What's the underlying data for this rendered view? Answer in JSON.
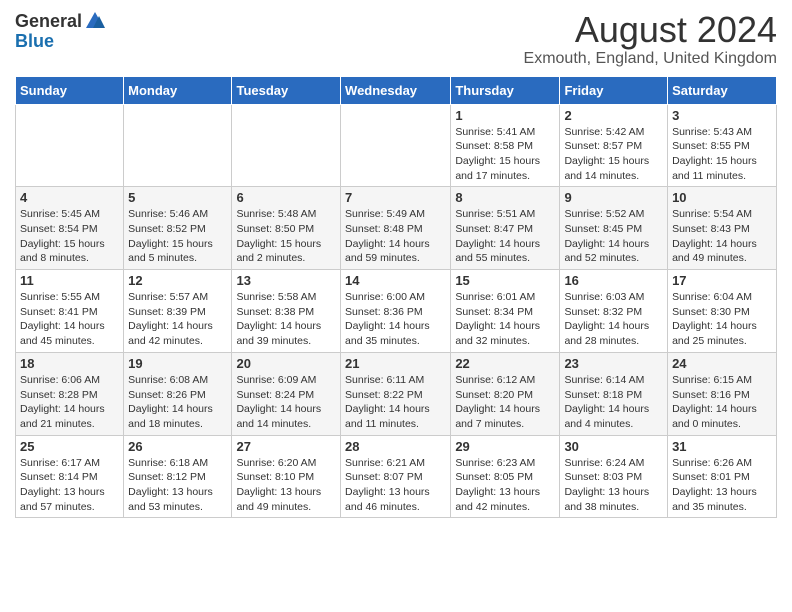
{
  "header": {
    "logo_general": "General",
    "logo_blue": "Blue",
    "title": "August 2024",
    "subtitle": "Exmouth, England, United Kingdom"
  },
  "weekdays": [
    "Sunday",
    "Monday",
    "Tuesday",
    "Wednesday",
    "Thursday",
    "Friday",
    "Saturday"
  ],
  "weeks": [
    [
      {
        "day": "",
        "sunrise": "",
        "sunset": "",
        "daylight": ""
      },
      {
        "day": "",
        "sunrise": "",
        "sunset": "",
        "daylight": ""
      },
      {
        "day": "",
        "sunrise": "",
        "sunset": "",
        "daylight": ""
      },
      {
        "day": "",
        "sunrise": "",
        "sunset": "",
        "daylight": ""
      },
      {
        "day": "1",
        "sunrise": "Sunrise: 5:41 AM",
        "sunset": "Sunset: 8:58 PM",
        "daylight": "Daylight: 15 hours and 17 minutes."
      },
      {
        "day": "2",
        "sunrise": "Sunrise: 5:42 AM",
        "sunset": "Sunset: 8:57 PM",
        "daylight": "Daylight: 15 hours and 14 minutes."
      },
      {
        "day": "3",
        "sunrise": "Sunrise: 5:43 AM",
        "sunset": "Sunset: 8:55 PM",
        "daylight": "Daylight: 15 hours and 11 minutes."
      }
    ],
    [
      {
        "day": "4",
        "sunrise": "Sunrise: 5:45 AM",
        "sunset": "Sunset: 8:54 PM",
        "daylight": "Daylight: 15 hours and 8 minutes."
      },
      {
        "day": "5",
        "sunrise": "Sunrise: 5:46 AM",
        "sunset": "Sunset: 8:52 PM",
        "daylight": "Daylight: 15 hours and 5 minutes."
      },
      {
        "day": "6",
        "sunrise": "Sunrise: 5:48 AM",
        "sunset": "Sunset: 8:50 PM",
        "daylight": "Daylight: 15 hours and 2 minutes."
      },
      {
        "day": "7",
        "sunrise": "Sunrise: 5:49 AM",
        "sunset": "Sunset: 8:48 PM",
        "daylight": "Daylight: 14 hours and 59 minutes."
      },
      {
        "day": "8",
        "sunrise": "Sunrise: 5:51 AM",
        "sunset": "Sunset: 8:47 PM",
        "daylight": "Daylight: 14 hours and 55 minutes."
      },
      {
        "day": "9",
        "sunrise": "Sunrise: 5:52 AM",
        "sunset": "Sunset: 8:45 PM",
        "daylight": "Daylight: 14 hours and 52 minutes."
      },
      {
        "day": "10",
        "sunrise": "Sunrise: 5:54 AM",
        "sunset": "Sunset: 8:43 PM",
        "daylight": "Daylight: 14 hours and 49 minutes."
      }
    ],
    [
      {
        "day": "11",
        "sunrise": "Sunrise: 5:55 AM",
        "sunset": "Sunset: 8:41 PM",
        "daylight": "Daylight: 14 hours and 45 minutes."
      },
      {
        "day": "12",
        "sunrise": "Sunrise: 5:57 AM",
        "sunset": "Sunset: 8:39 PM",
        "daylight": "Daylight: 14 hours and 42 minutes."
      },
      {
        "day": "13",
        "sunrise": "Sunrise: 5:58 AM",
        "sunset": "Sunset: 8:38 PM",
        "daylight": "Daylight: 14 hours and 39 minutes."
      },
      {
        "day": "14",
        "sunrise": "Sunrise: 6:00 AM",
        "sunset": "Sunset: 8:36 PM",
        "daylight": "Daylight: 14 hours and 35 minutes."
      },
      {
        "day": "15",
        "sunrise": "Sunrise: 6:01 AM",
        "sunset": "Sunset: 8:34 PM",
        "daylight": "Daylight: 14 hours and 32 minutes."
      },
      {
        "day": "16",
        "sunrise": "Sunrise: 6:03 AM",
        "sunset": "Sunset: 8:32 PM",
        "daylight": "Daylight: 14 hours and 28 minutes."
      },
      {
        "day": "17",
        "sunrise": "Sunrise: 6:04 AM",
        "sunset": "Sunset: 8:30 PM",
        "daylight": "Daylight: 14 hours and 25 minutes."
      }
    ],
    [
      {
        "day": "18",
        "sunrise": "Sunrise: 6:06 AM",
        "sunset": "Sunset: 8:28 PM",
        "daylight": "Daylight: 14 hours and 21 minutes."
      },
      {
        "day": "19",
        "sunrise": "Sunrise: 6:08 AM",
        "sunset": "Sunset: 8:26 PM",
        "daylight": "Daylight: 14 hours and 18 minutes."
      },
      {
        "day": "20",
        "sunrise": "Sunrise: 6:09 AM",
        "sunset": "Sunset: 8:24 PM",
        "daylight": "Daylight: 14 hours and 14 minutes."
      },
      {
        "day": "21",
        "sunrise": "Sunrise: 6:11 AM",
        "sunset": "Sunset: 8:22 PM",
        "daylight": "Daylight: 14 hours and 11 minutes."
      },
      {
        "day": "22",
        "sunrise": "Sunrise: 6:12 AM",
        "sunset": "Sunset: 8:20 PM",
        "daylight": "Daylight: 14 hours and 7 minutes."
      },
      {
        "day": "23",
        "sunrise": "Sunrise: 6:14 AM",
        "sunset": "Sunset: 8:18 PM",
        "daylight": "Daylight: 14 hours and 4 minutes."
      },
      {
        "day": "24",
        "sunrise": "Sunrise: 6:15 AM",
        "sunset": "Sunset: 8:16 PM",
        "daylight": "Daylight: 14 hours and 0 minutes."
      }
    ],
    [
      {
        "day": "25",
        "sunrise": "Sunrise: 6:17 AM",
        "sunset": "Sunset: 8:14 PM",
        "daylight": "Daylight: 13 hours and 57 minutes."
      },
      {
        "day": "26",
        "sunrise": "Sunrise: 6:18 AM",
        "sunset": "Sunset: 8:12 PM",
        "daylight": "Daylight: 13 hours and 53 minutes."
      },
      {
        "day": "27",
        "sunrise": "Sunrise: 6:20 AM",
        "sunset": "Sunset: 8:10 PM",
        "daylight": "Daylight: 13 hours and 49 minutes."
      },
      {
        "day": "28",
        "sunrise": "Sunrise: 6:21 AM",
        "sunset": "Sunset: 8:07 PM",
        "daylight": "Daylight: 13 hours and 46 minutes."
      },
      {
        "day": "29",
        "sunrise": "Sunrise: 6:23 AM",
        "sunset": "Sunset: 8:05 PM",
        "daylight": "Daylight: 13 hours and 42 minutes."
      },
      {
        "day": "30",
        "sunrise": "Sunrise: 6:24 AM",
        "sunset": "Sunset: 8:03 PM",
        "daylight": "Daylight: 13 hours and 38 minutes."
      },
      {
        "day": "31",
        "sunrise": "Sunrise: 6:26 AM",
        "sunset": "Sunset: 8:01 PM",
        "daylight": "Daylight: 13 hours and 35 minutes."
      }
    ]
  ]
}
